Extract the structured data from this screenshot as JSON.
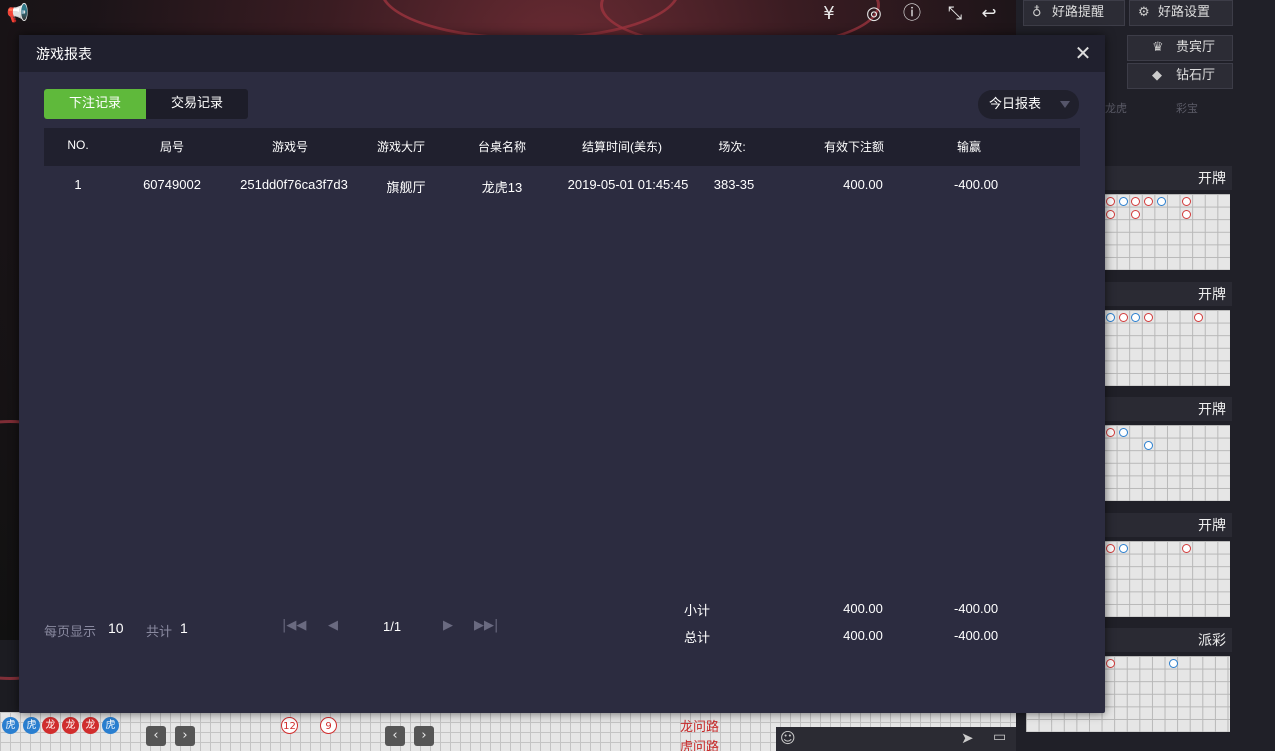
{
  "background": {
    "top_icons": [
      "currency-icon",
      "chip-icon",
      "info-icon",
      "fullscreen-icon",
      "back-icon"
    ]
  },
  "sidebar": {
    "buttons": [
      {
        "label": "好路提醒",
        "icon": "medal-icon"
      },
      {
        "label": "好路设置",
        "icon": "gear-icon"
      },
      {
        "label": "贵宾厅",
        "icon": "crown-icon"
      },
      {
        "label": "钻石厅",
        "icon": "diamond-icon"
      }
    ],
    "faded_tabs": [
      "龙虎",
      "彩宝"
    ],
    "road_headers": [
      "开牌",
      "开牌",
      "开牌",
      "开牌",
      "派彩"
    ]
  },
  "bottom": {
    "road_labels": [
      "龙问路",
      "虎问路"
    ],
    "chips": [
      "虎",
      "虎",
      "龙",
      "龙",
      "龙",
      "虎"
    ],
    "numbers": [
      "12",
      "9"
    ]
  },
  "modal": {
    "title": "游戏报表",
    "tabs": [
      {
        "label": "下注记录",
        "active": true
      },
      {
        "label": "交易记录",
        "active": false
      }
    ],
    "report_select": "今日报表",
    "table": {
      "columns": [
        "NO.",
        "局号",
        "游戏号",
        "游戏大厅",
        "台桌名称",
        "结算时间(美东)",
        "场次:",
        "有效下注额",
        "输赢"
      ],
      "rows": [
        [
          "1",
          "60749002",
          "251dd0f76ca3f7d3",
          "旗舰厅",
          "龙虎13",
          "2019-05-01 01:45:45",
          "383-35",
          "400.00",
          "-400.00"
        ]
      ]
    },
    "pager": {
      "per_page_label": "每页显示",
      "per_page": "10",
      "total_label": "共计",
      "total": "1",
      "page": "1/1"
    },
    "summary": {
      "subtotal_label": "小计",
      "subtotal_bet": "400.00",
      "subtotal_win": "-400.00",
      "total_label": "总计",
      "total_bet": "400.00",
      "total_win": "-400.00"
    },
    "colors": {
      "active_tab": "#5fb93b",
      "panel": "#2c2c40",
      "header": "#20202e"
    }
  }
}
